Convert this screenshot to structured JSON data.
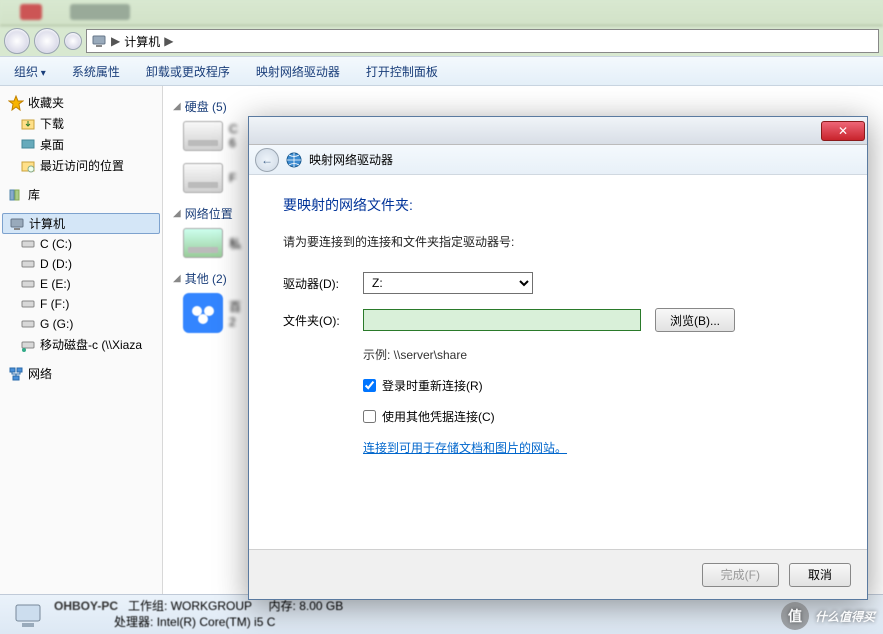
{
  "addressbar": {
    "root": "计算机",
    "sep": "▶"
  },
  "toolbar": {
    "organize": "组织",
    "sys_props": "系统属性",
    "uninstall": "卸载或更改程序",
    "map_drive": "映射网络驱动器",
    "ctrlpanel": "打开控制面板"
  },
  "sidebar": {
    "favorites": "收藏夹",
    "downloads": "下载",
    "desktop": "桌面",
    "recent": "最近访问的位置",
    "libraries": "库",
    "computer": "计算机",
    "drives": [
      {
        "label": "C (C:)"
      },
      {
        "label": "D (D:)"
      },
      {
        "label": "E (E:)"
      },
      {
        "label": "F (F:)"
      },
      {
        "label": "G (G:)"
      },
      {
        "label": "移动磁盘-c (\\\\Xiaza"
      }
    ],
    "network": "网络"
  },
  "main": {
    "disks_header": "硬盘 (5)",
    "netloc_header": "网络位置",
    "other_header": "其他 (2)"
  },
  "modal": {
    "nav_title": "映射网络驱动器",
    "heading": "要映射的网络文件夹:",
    "subtitle": "请为要连接到的连接和文件夹指定驱动器号:",
    "drive_label": "驱动器(D):",
    "drive_value": "Z:",
    "folder_label": "文件夹(O):",
    "folder_value": "",
    "browse": "浏览(B)...",
    "example": "示例: \\\\server\\share",
    "reconnect": "登录时重新连接(R)",
    "other_cred": "使用其他凭据连接(C)",
    "link": "连接到可用于存储文档和图片的网站。",
    "finish": "完成(F)",
    "cancel": "取消"
  },
  "details": {
    "name": "OHBOY-PC",
    "workgroup_label": "工作组:",
    "workgroup": "WORKGROUP",
    "cpu_label": "处理器:",
    "cpu": "Intel(R) Core(TM) i5 C",
    "mem_label": "内存:",
    "mem": "8.00 GB"
  },
  "watermark": "什么值得买"
}
